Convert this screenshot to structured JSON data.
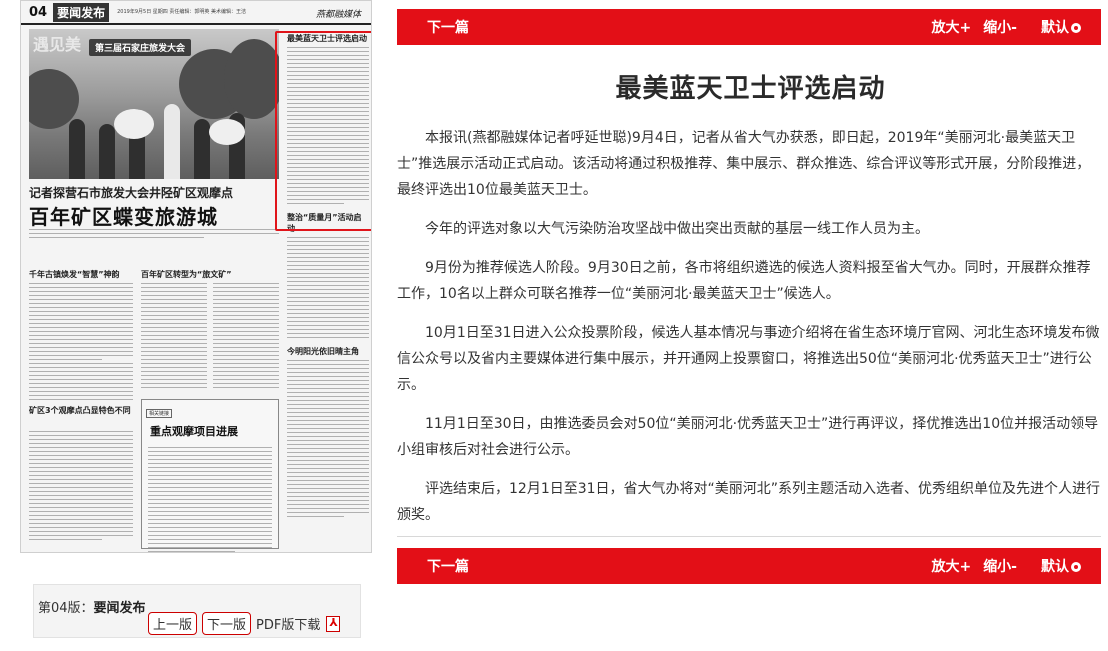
{
  "newspaper": {
    "page_no": "04",
    "section": "要闻发布",
    "header_meta": "2019年9月5日 星期四 责任编辑：郭明英 美术编辑：王洁",
    "logo": "燕都融媒体",
    "photo_banner": "第三届石家庄旅发大会",
    "photo_deco": "遇见美",
    "sub_headline": "记者探营石市旅发大会井陉矿区观摩点",
    "headline": "百年矿区蝶变旅游城",
    "sections": [
      "千年古镇焕发“智慧”神韵",
      "百年矿区转型为“旅文矿”",
      "矿区3个观摩点凸显特色不同"
    ],
    "box_label": "相关链接",
    "box_title": "重点观摩项目进展",
    "strip_titles": [
      "最美蓝天卫士评选启动",
      "整治“质量月”活动启动",
      "今明阳光依旧晴主角"
    ]
  },
  "page_info": {
    "edition_prefix": "第04版：",
    "edition_name": "要闻发布",
    "prev_label": "上一版",
    "next_label": "下一版",
    "pdf_label": "PDF版下载"
  },
  "toolbar": {
    "next_article": "下一篇",
    "zoom_in": "放大+",
    "zoom_out": "缩小-",
    "default": "默认"
  },
  "article": {
    "title": "最美蓝天卫士评选启动",
    "paragraphs": [
      "本报讯(燕都融媒体记者呼延世聪)9月4日，记者从省大气办获悉，即日起，2019年“美丽河北·最美蓝天卫士”推选展示活动正式启动。该活动将通过积极推荐、集中展示、群众推选、综合评议等形式开展，分阶段推进，最终评选出10位最美蓝天卫士。",
      "今年的评选对象以大气污染防治攻坚战中做出突出贡献的基层一线工作人员为主。",
      "9月份为推荐候选人阶段。9月30日之前，各市将组织遴选的候选人资料报至省大气办。同时，开展群众推荐工作，10名以上群众可联名推荐一位“美丽河北·最美蓝天卫士”候选人。",
      "10月1日至31日进入公众投票阶段，候选人基本情况与事迹介绍将在省生态环境厅官网、河北生态环境发布微信公众号以及省内主要媒体进行集中展示，并开通网上投票窗口，将推选出50位“美丽河北·优秀蓝天卫士”进行公示。",
      "11月1日至30日，由推选委员会对50位“美丽河北·优秀蓝天卫士”进行再评议，择优推选出10位并报活动领导小组审核后对社会进行公示。",
      "评选结束后，12月1日至31日，省大气办将对“美丽河北”系列主题活动入选者、优秀组织单位及先进个人进行颁奖。"
    ]
  },
  "colors": {
    "accent_red": "#e30f17",
    "highlight_border": "#e0141a"
  }
}
